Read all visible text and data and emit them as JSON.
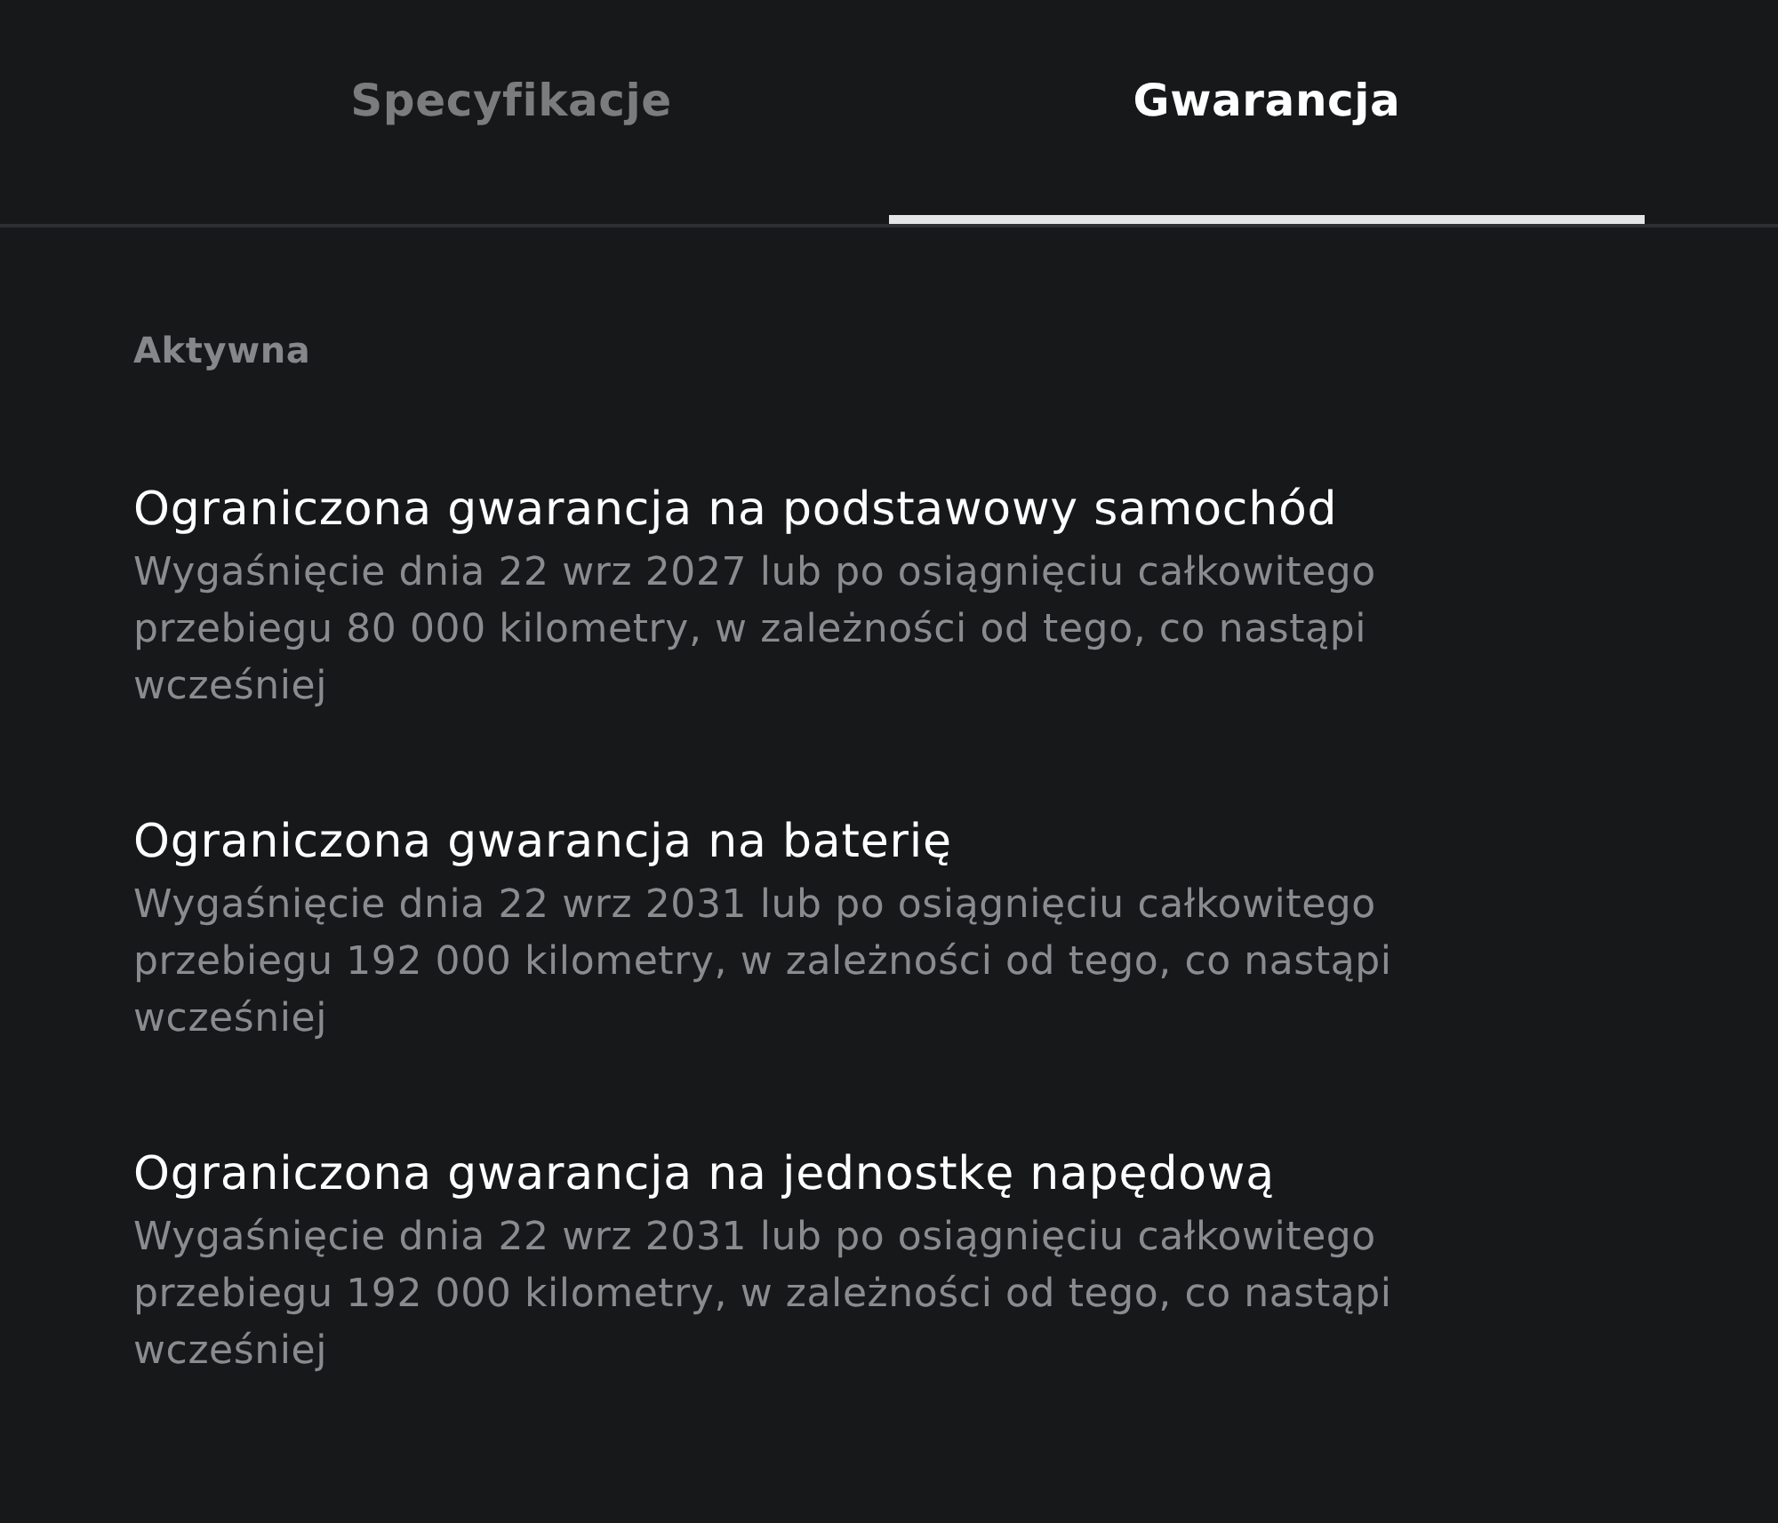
{
  "tabs": [
    {
      "label": "Specyfikacje",
      "selected": false
    },
    {
      "label": "Gwarancja",
      "selected": true
    }
  ],
  "section": {
    "heading": "Aktywna"
  },
  "warranties": [
    {
      "title": "Ograniczona gwarancja na podstawowy samochód",
      "description": "Wygaśnięcie dnia 22 wrz 2027 lub po osiągnięciu całkowitego przebiegu 80 000 kilometry, w zależności od tego, co nastąpi wcześniej"
    },
    {
      "title": "Ograniczona gwarancja na baterię",
      "description": "Wygaśnięcie dnia 22 wrz 2031 lub po osiągnięciu całkowitego przebiegu 192 000 kilometry, w zależności od tego, co nastąpi wcześniej"
    },
    {
      "title": "Ograniczona gwarancja na jednostkę napędową",
      "description": "Wygaśnięcie dnia 22 wrz 2031 lub po osiągnięciu całkowitego przebiegu 192 000 kilometry, w zależności od tego, co nastąpi wcześniej"
    }
  ]
}
